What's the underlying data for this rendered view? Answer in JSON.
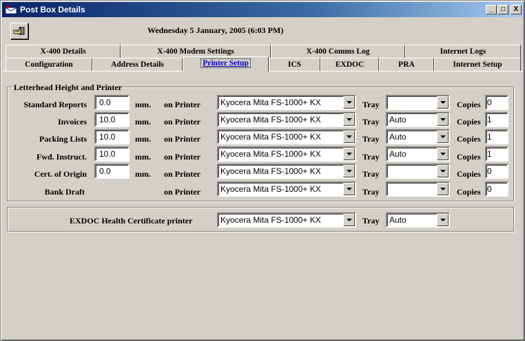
{
  "window": {
    "title": "Post Box Details",
    "minimize_label": "_",
    "maximize_label": "□",
    "close_label": "X"
  },
  "header": {
    "datetime": "Wednesday 5 January, 2005  (6:03 PM)"
  },
  "tabs_row1": [
    {
      "label": "X-400 Details"
    },
    {
      "label": "X-400 Modem Settings"
    },
    {
      "label": "X-400 Comms Log"
    },
    {
      "label": "Internet Logs"
    }
  ],
  "tabs_row2": [
    {
      "label": "Configuration"
    },
    {
      "label": "Address Details"
    },
    {
      "label": "Printer Setup",
      "active": true
    },
    {
      "label": "ICS"
    },
    {
      "label": "EXDOC"
    },
    {
      "label": "PRA"
    },
    {
      "label": "Internet Setup"
    }
  ],
  "letterhead": {
    "group_title": "Letterhead Height and Printer",
    "mm_label": "mm.",
    "on_printer_label": "on Printer",
    "tray_label": "Tray",
    "copies_label": "Copies",
    "rows": [
      {
        "label": "Standard Reports",
        "height": "0.0",
        "printer": "Kyocera Mita FS-1000+ KX",
        "tray": "",
        "copies": "0"
      },
      {
        "label": "Invoices",
        "height": "10.0",
        "printer": "Kyocera Mita FS-1000+ KX",
        "tray": "Auto",
        "copies": "1"
      },
      {
        "label": "Packing Lists",
        "height": "10.0",
        "printer": "Kyocera Mita FS-1000+ KX",
        "tray": "Auto",
        "copies": "1"
      },
      {
        "label": "Fwd. Instruct.",
        "height": "10.0",
        "printer": "Kyocera Mita FS-1000+ KX",
        "tray": "Auto",
        "copies": "1"
      },
      {
        "label": "Cert. of Origin",
        "height": "0.0",
        "printer": "Kyocera Mita FS-1000+ KX",
        "tray": "",
        "copies": "0"
      },
      {
        "label": "Bank Draft",
        "printer": "Kyocera Mita FS-1000+ KX",
        "tray": "",
        "copies": "0"
      }
    ]
  },
  "exdoc": {
    "label": "EXDOC Health Certificate printer",
    "printer": "Kyocera Mita FS-1000+ KX",
    "tray_label": "Tray",
    "tray": "Auto"
  }
}
